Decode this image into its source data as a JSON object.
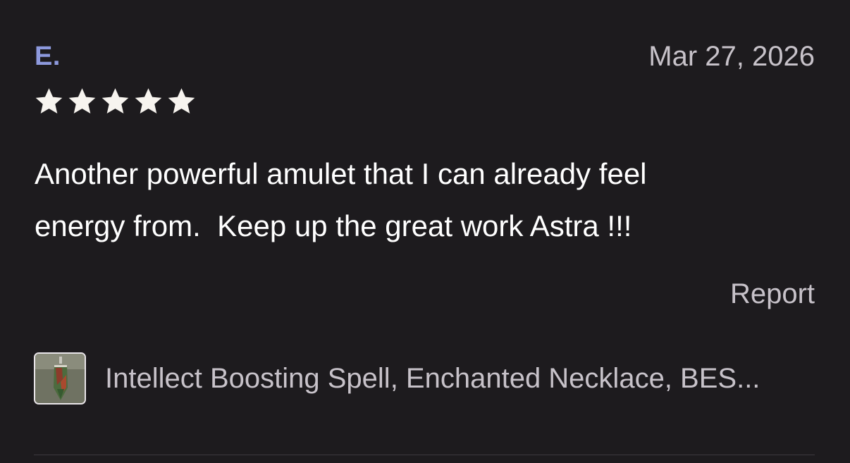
{
  "review": {
    "reviewer_name": "E.",
    "date": "Mar 27, 2026",
    "rating": 5,
    "rating_max": 5,
    "text_line1": "Another powerful amulet that I can already feel",
    "text_line2": "energy from.  Keep up the great work Astra !!!",
    "report_label": "Report"
  },
  "product": {
    "title": "Intellect Boosting Spell, Enchanted Necklace, BES...",
    "thumbnail_icon": "necklace-thumbnail"
  },
  "colors": {
    "background": "#1d1b1e",
    "reviewer_name": "#8d99dd",
    "secondary_text": "#c7c2c9",
    "star": "#f7f4ef"
  }
}
